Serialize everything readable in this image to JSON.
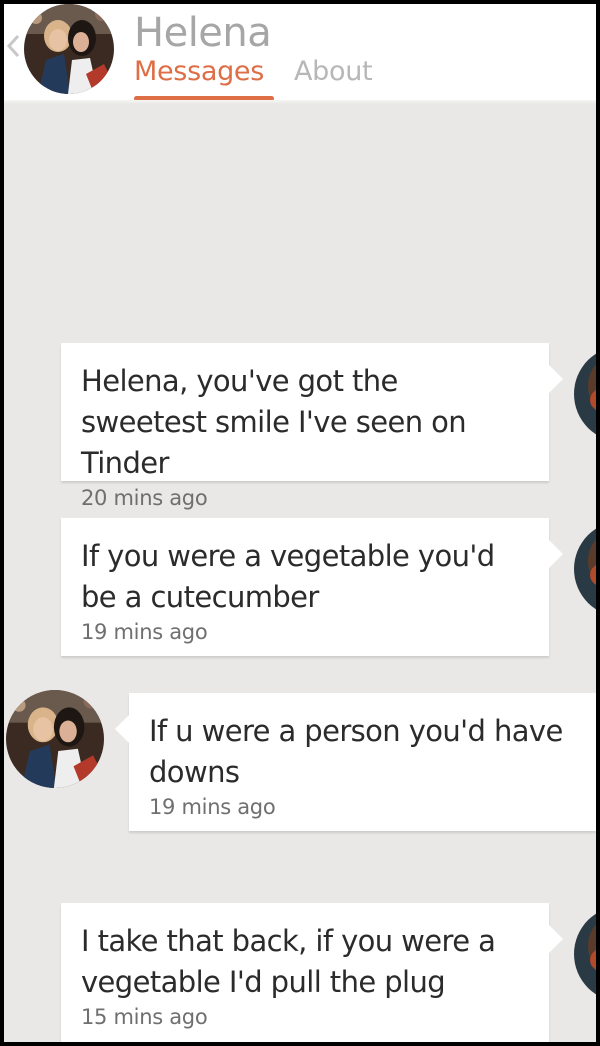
{
  "header": {
    "name": "Helena",
    "tabs": [
      {
        "label": "Messages",
        "active": true
      },
      {
        "label": "About",
        "active": false
      }
    ],
    "accent_color": "#de6e46"
  },
  "messages": [
    {
      "text": "Helena, you've got the sweetest smile I've seen on Tinder",
      "time": "20 mins ago",
      "side": "right"
    },
    {
      "text": "If you were a vegetable you'd be a cutecumber",
      "time": "19 mins ago",
      "side": "right"
    },
    {
      "text": "If u were a person you'd have downs",
      "time": "19 mins ago",
      "side": "left"
    },
    {
      "text": "I take that back, if you were a vegetable I'd pull the plug",
      "time": "15 mins ago",
      "side": "right"
    }
  ]
}
